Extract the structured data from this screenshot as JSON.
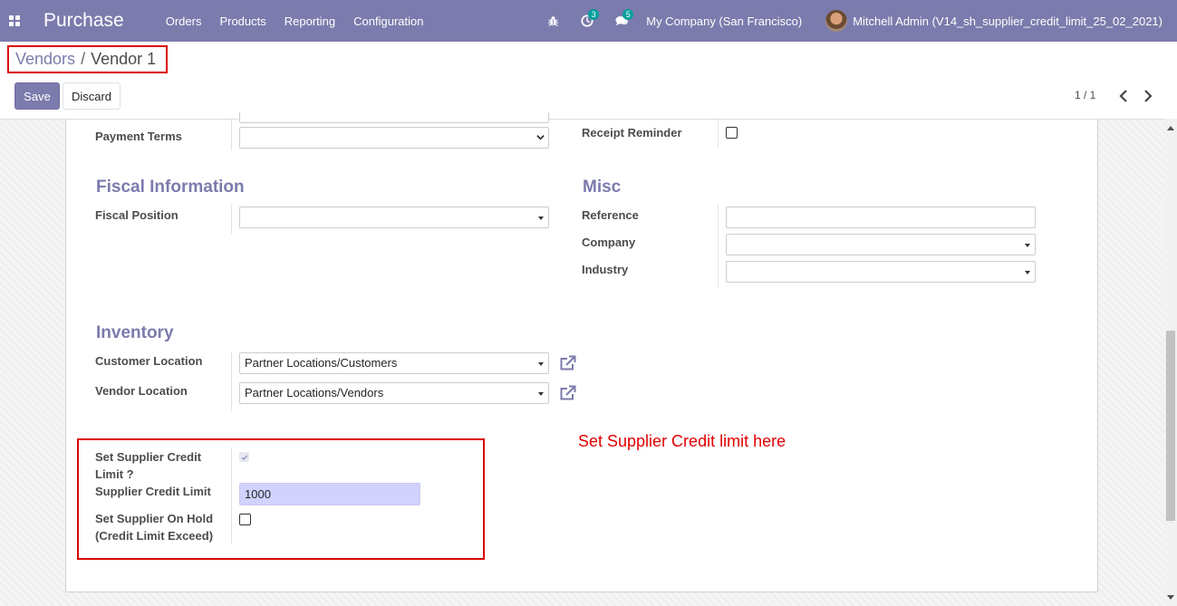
{
  "navbar": {
    "app_name": "Purchase",
    "menu": [
      "Orders",
      "Products",
      "Reporting",
      "Configuration"
    ],
    "activity_count": "3",
    "messages_count": "5",
    "company": "My Company (San Francisco)",
    "user": "Mitchell Admin (V14_sh_supplier_credit_limit_25_02_2021)"
  },
  "breadcrumb": {
    "parent": "Vendors",
    "separator": "/",
    "current": "Vendor 1"
  },
  "buttons": {
    "save": "Save",
    "discard": "Discard"
  },
  "pager": {
    "value": "1 / 1"
  },
  "form": {
    "payment_terms_label": "Payment Terms",
    "payment_terms_value": "",
    "receipt_reminder_label": "Receipt Reminder",
    "receipt_reminder_checked": false,
    "fiscal_section": "Fiscal Information",
    "fiscal_position_label": "Fiscal Position",
    "fiscal_position_value": "",
    "misc_section": "Misc",
    "reference_label": "Reference",
    "reference_value": "",
    "company_label": "Company",
    "company_value": "",
    "industry_label": "Industry",
    "industry_value": "",
    "inventory_section": "Inventory",
    "customer_location_label": "Customer Location",
    "customer_location_value": "Partner Locations/Customers",
    "vendor_location_label": "Vendor Location",
    "vendor_location_value": "Partner Locations/Vendors",
    "set_credit_label_line1": "Set Supplier Credit",
    "set_credit_label_line2": "Limit ?",
    "set_credit_checked": true,
    "credit_limit_label": "Supplier Credit Limit",
    "credit_limit_value": "1000",
    "on_hold_label_line1": "Set Supplier On Hold",
    "on_hold_label_line2": "(Credit Limit Exceed)",
    "on_hold_checked": false
  },
  "annotation": "Set Supplier Credit limit here",
  "colors": {
    "navbar": "#7c7bad",
    "accent": "#7c7bad",
    "annotation_red": "#e10000",
    "highlight_input": "#d2d2ff"
  }
}
